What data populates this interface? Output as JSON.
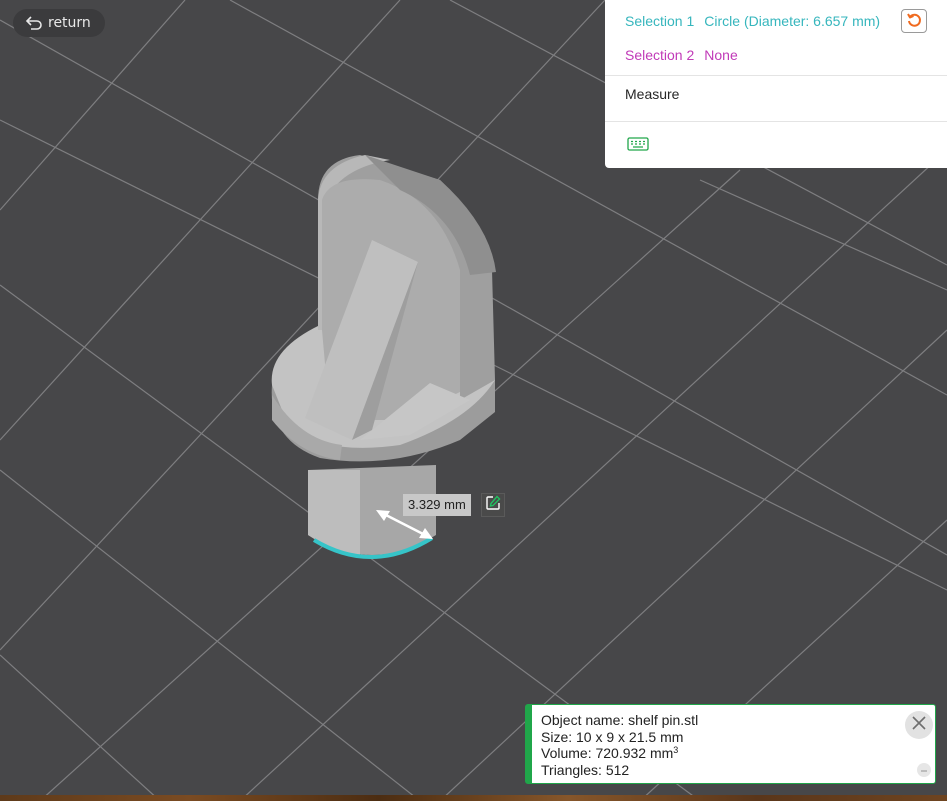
{
  "toolbar": {
    "return_label": "return",
    "return_icon": "return-arrow-icon"
  },
  "measure_panel": {
    "selection1": {
      "label": "Selection 1",
      "value": "Circle (Diameter: 6.657 mm)",
      "color": "#36b6bd"
    },
    "selection2": {
      "label": "Selection 2",
      "value": "None",
      "color": "#c13ab8"
    },
    "reset_icon": "reset-icon",
    "measure_label": "Measure",
    "keyboard_icon": "keyboard-icon"
  },
  "dimension": {
    "value": "3.329 mm",
    "edit_icon": "edit-icon"
  },
  "object_info": {
    "name": "Object name: shelf pin.stl",
    "size": "Size: 10 x 9 x 21.5 mm",
    "volume": "Volume: 720.932 mm",
    "volume_unit_sup": "3",
    "triangles": "Triangles: 512",
    "accent": "#20a64a"
  },
  "colors": {
    "background": "#474749",
    "grid": "#8e8e8e",
    "model": "#b4b4b4",
    "highlight": "#36c4c8"
  }
}
